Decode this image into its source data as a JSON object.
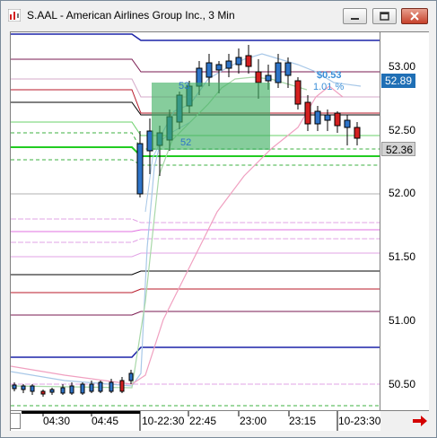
{
  "window": {
    "title": "S.AAL - American Airlines Group Inc., 3 Min",
    "minimize_icon": "minimize-icon",
    "maximize_icon": "maximize-icon",
    "close_icon": "close-icon"
  },
  "price_axis": {
    "labels": [
      "53.00",
      "52.50",
      "52.00",
      "51.50",
      "51.00",
      "50.50"
    ],
    "current_price_high": "52.89",
    "current_price_last": "52.36",
    "high_box_color": "#1f6fb5",
    "last_box_color": "#d3d3d3"
  },
  "time_axis": {
    "labels": [
      "04:30",
      "04:45",
      "10-22:30",
      "22:45",
      "23:00",
      "23:15",
      "10-23:30"
    ]
  },
  "annotations": {
    "change_value": "$0.53",
    "change_percent": "1.01 %",
    "box_top_label": "53",
    "box_bottom_label": "52"
  },
  "colors": {
    "up_candle": "#2e74c8",
    "down_candle": "#d42020",
    "trend_box": "#3caf5f",
    "change_text": "#3a8fd8",
    "nav_arrow": "#d40000"
  },
  "nav": {
    "arrow_icon": "right-arrow-icon"
  }
}
